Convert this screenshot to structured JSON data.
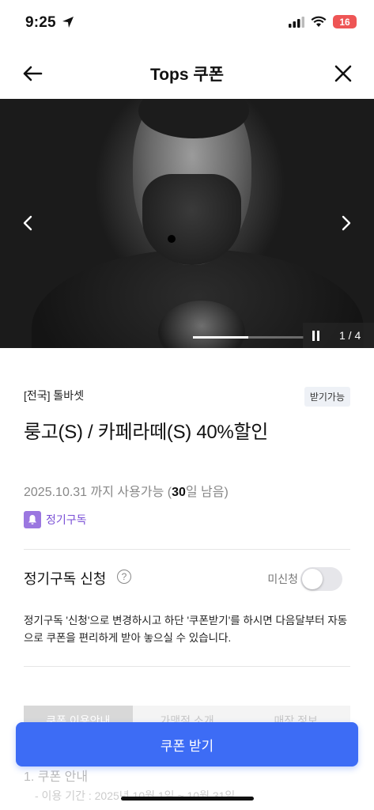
{
  "status": {
    "time": "9:25",
    "battery": "16",
    "battery_level_percent": 16
  },
  "header": {
    "title": "Tops 쿠폰",
    "back_icon": "arrow-left-icon",
    "close_icon": "close-icon"
  },
  "carousel": {
    "page_indicator": "1 / 4",
    "progress_fraction": 0.5
  },
  "coupon": {
    "store": "[전국] 톨바셋",
    "badge": "받기가능",
    "name": "룽고(S) / 카페라떼(S) 40%할인",
    "period_prefix": "2025.10.31 까지 사용가능 (",
    "days_left": "30",
    "period_suffix": "일 남음)",
    "tag": "정기구독"
  },
  "subscription": {
    "title": "정기구독 신청",
    "toggle_label": "미신청",
    "toggle_on": false,
    "description": "정기구독 '신청'으로 변경하시고 하단 '쿠폰받기'를 하시면 다음달부터 자동으로 쿠폰을 편리하게 받아 놓으실 수 있습니다."
  },
  "tabs": [
    "쿠폰 이용안내",
    "가맹점 소개",
    "매장 정보"
  ],
  "info": {
    "section_title": "1. 쿠폰 안내",
    "section_line": "- 이용 기간 : 2025년 10월 1일 ~ 10월 31일"
  },
  "cta": {
    "label": "쿠폰 받기"
  }
}
